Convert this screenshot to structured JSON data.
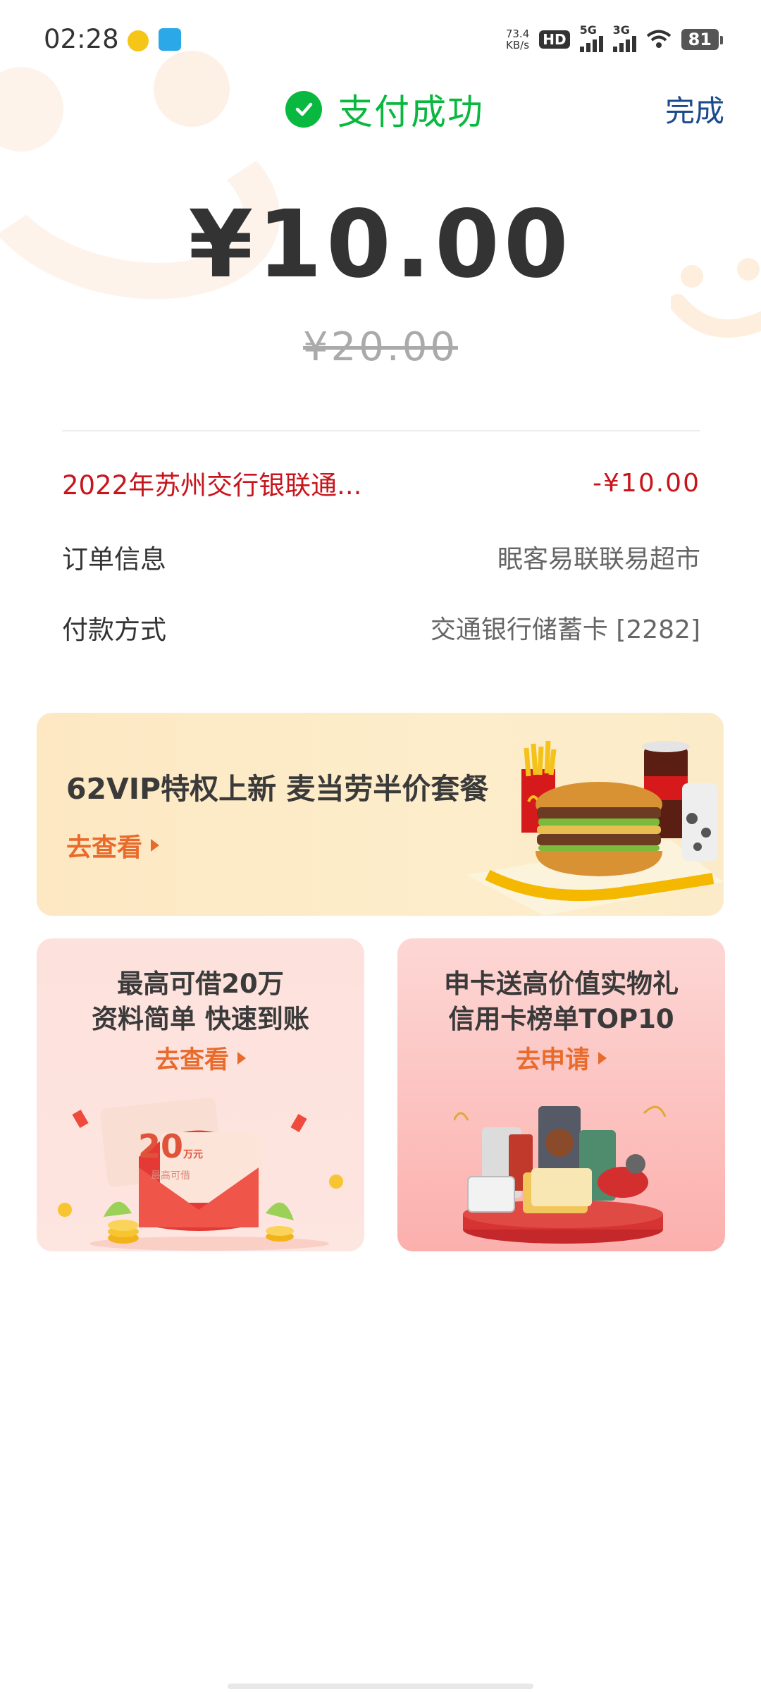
{
  "status_bar": {
    "time": "02:28",
    "net_speed_value": "73.4",
    "net_speed_unit": "KB/s",
    "hd_label": "HD",
    "hd_sub": "1",
    "signal1_label": "5G",
    "signal2_label": "3G",
    "battery_level": "81"
  },
  "header": {
    "title": "支付成功",
    "done_label": "完成"
  },
  "payment": {
    "amount": "¥10.00",
    "original_amount": "¥20.00"
  },
  "details": {
    "discount_label": "2022年苏州交行银联通...",
    "discount_value": "-¥10.00",
    "order_label": "订单信息",
    "order_value": "眠客易联联易超市",
    "method_label": "付款方式",
    "method_value": "交通银行储蓄卡 [2282]"
  },
  "promo_banner": {
    "headline": "62VIP特权上新 麦当劳半价套餐",
    "cta": "去查看"
  },
  "loan_card": {
    "line1": "最高可借20万",
    "line2": "资料简单  快速到账",
    "cta": "去查看",
    "amount_num": "20",
    "amount_unit": "万元",
    "amount_caption": "最高可借"
  },
  "credit_card": {
    "line1": "申卡送高价值实物礼",
    "line2": "信用卡榜单TOP10",
    "cta": "去申请"
  },
  "colors": {
    "success_green": "#09b83e",
    "done_blue": "#1a4b8c",
    "discount_red": "#c8151d",
    "cta_orange": "#e96b2c"
  }
}
